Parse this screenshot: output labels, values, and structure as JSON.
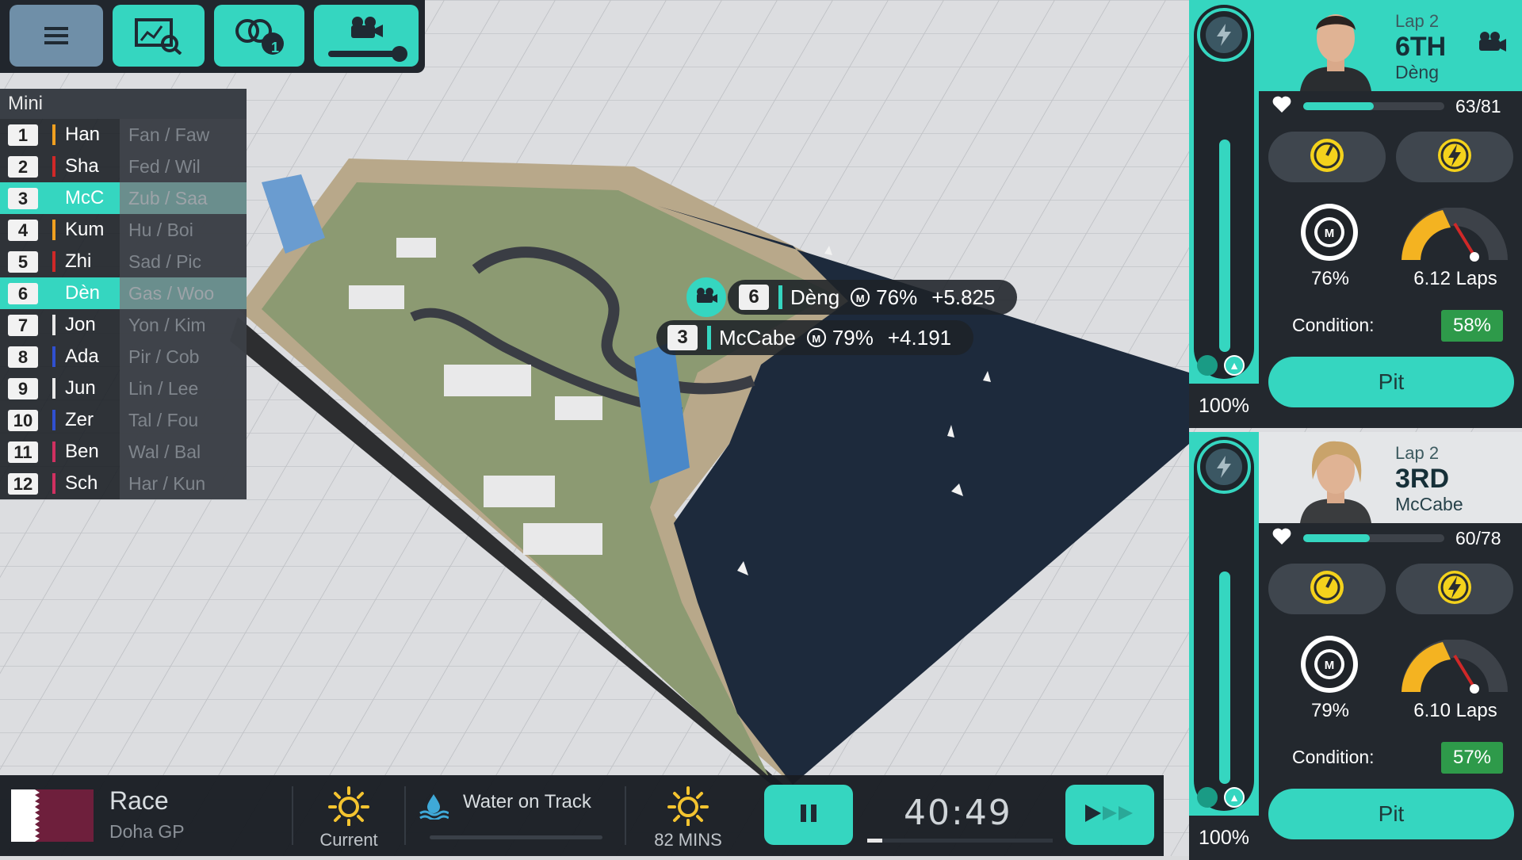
{
  "colors": {
    "accent": "#35d6c0",
    "condition_green": "#2e9a4a",
    "panel": "#23282e"
  },
  "toolbar": {
    "icons": [
      "menu-icon",
      "telemetry-icon",
      "pit-board-icon",
      "camera-icon"
    ],
    "pit_board_badge": "1"
  },
  "standings": {
    "title": "Mini",
    "rows": [
      {
        "pos": "1",
        "name": "Han",
        "team": "Fan / Faw",
        "color": "#f0a020",
        "highlight": false
      },
      {
        "pos": "2",
        "name": "Sha",
        "team": "Fed / Wil",
        "color": "#d02828",
        "highlight": false
      },
      {
        "pos": "3",
        "name": "McC",
        "team": "Zub / Saa",
        "color": "#35d6c0",
        "highlight": true
      },
      {
        "pos": "4",
        "name": "Kum",
        "team": "Hu / Boi",
        "color": "#f0a020",
        "highlight": false
      },
      {
        "pos": "5",
        "name": "Zhi",
        "team": "Sad / Pic",
        "color": "#d02828",
        "highlight": false
      },
      {
        "pos": "6",
        "name": "Dèn",
        "team": "Gas / Woo",
        "color": "#35d6c0",
        "highlight": true
      },
      {
        "pos": "7",
        "name": "Jon",
        "team": "Yon / Kim",
        "color": "#e8e8e8",
        "highlight": false
      },
      {
        "pos": "8",
        "name": "Ada",
        "team": "Pir / Cob",
        "color": "#3050d0",
        "highlight": false
      },
      {
        "pos": "9",
        "name": "Jun",
        "team": "Lin / Lee",
        "color": "#e8e8e8",
        "highlight": false
      },
      {
        "pos": "10",
        "name": "Zer",
        "team": "Tal / Fou",
        "color": "#3050d0",
        "highlight": false
      },
      {
        "pos": "11",
        "name": "Ben",
        "team": "Wal / Bal",
        "color": "#d03060",
        "highlight": false
      },
      {
        "pos": "12",
        "name": "Sch",
        "team": "Har / Kun",
        "color": "#d03060",
        "highlight": false
      }
    ]
  },
  "tooltips": [
    {
      "pos": "6",
      "name": "Dèng",
      "mode": "M",
      "pct": "76%",
      "gap": "+5.825"
    },
    {
      "pos": "3",
      "name": "McCabe",
      "mode": "M",
      "pct": "79%",
      "gap": "+4.191"
    }
  ],
  "drivers": [
    {
      "lap": "Lap 2",
      "place": "6TH",
      "name": "Dèng",
      "health": "63/81",
      "health_frac": 0.5,
      "mode_pct": "76%",
      "fuel_laps": "6.12 Laps",
      "condition_label": "Condition:",
      "condition": "58%",
      "fuel_pct": "100%",
      "pit_label": "Pit",
      "header_bg": "#35d6c0"
    },
    {
      "lap": "Lap 2",
      "place": "3RD",
      "name": "McCabe",
      "health": "60/78",
      "health_frac": 0.47,
      "mode_pct": "79%",
      "fuel_laps": "6.10 Laps",
      "condition_label": "Condition:",
      "condition": "57%",
      "fuel_pct": "100%",
      "pit_label": "Pit",
      "header_bg": "#e4e6e8"
    }
  ],
  "bottom": {
    "race_title": "Race",
    "race_subtitle": "Doha GP",
    "weather_current": "Current",
    "water_label": "Water on Track",
    "weather_later": "82 MINS",
    "timer": "40:49",
    "timer_progress": 0.08
  }
}
